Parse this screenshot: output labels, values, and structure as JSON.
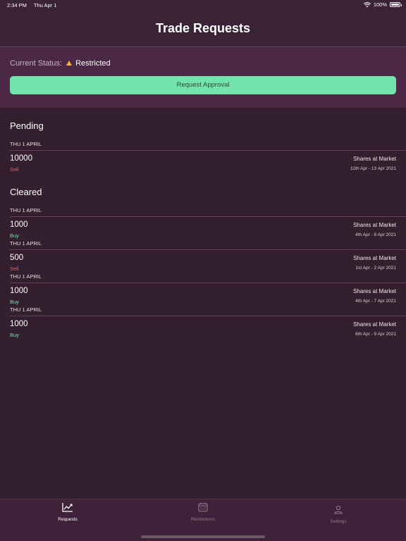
{
  "status_bar": {
    "time": "2:34 PM",
    "date": "Thu Apr 1",
    "battery": "100%"
  },
  "header": {
    "title": "Trade Requests"
  },
  "status_panel": {
    "label": "Current Status:",
    "value": "Restricted",
    "button_label": "Request Approval"
  },
  "pending": {
    "title": "Pending",
    "groups": [
      {
        "date": "THU 1 APRIL",
        "qty": "10000",
        "side": "Sell",
        "instrument": "Shares at Market",
        "range": "12th Apr - 13 Apr 2021"
      }
    ]
  },
  "cleared": {
    "title": "Cleared",
    "groups": [
      {
        "date": "THU 1 APRIL",
        "qty": "1000",
        "side": "Buy",
        "instrument": "Shares at Market",
        "range": "4th Apr - 8 Apr 2021"
      },
      {
        "date": "THU 1 APRIL",
        "qty": "500",
        "side": "Sell",
        "instrument": "Shares at Market",
        "range": "1st Apr - 2 Apr 2021"
      },
      {
        "date": "THU 1 APRIL",
        "qty": "1000",
        "side": "Buy",
        "instrument": "Shares at Market",
        "range": "4th Apr - 7 Apr 2021"
      },
      {
        "date": "THU 1 APRIL",
        "qty": "1000",
        "side": "Buy",
        "instrument": "Shares at Market",
        "range": "6th Apr - 9 Apr 2021"
      }
    ]
  },
  "tabs": [
    {
      "label": "Requests",
      "icon": "chart-line-icon",
      "active": true
    },
    {
      "label": "Restrictions",
      "icon": "calendar-icon",
      "active": false
    },
    {
      "label": "Settings",
      "icon": "person-icon",
      "active": false
    }
  ],
  "colors": {
    "accent": "#72e3ab",
    "sell": "#ea5b6e",
    "buy": "#72e3ab",
    "warning": "#f4b63c"
  }
}
